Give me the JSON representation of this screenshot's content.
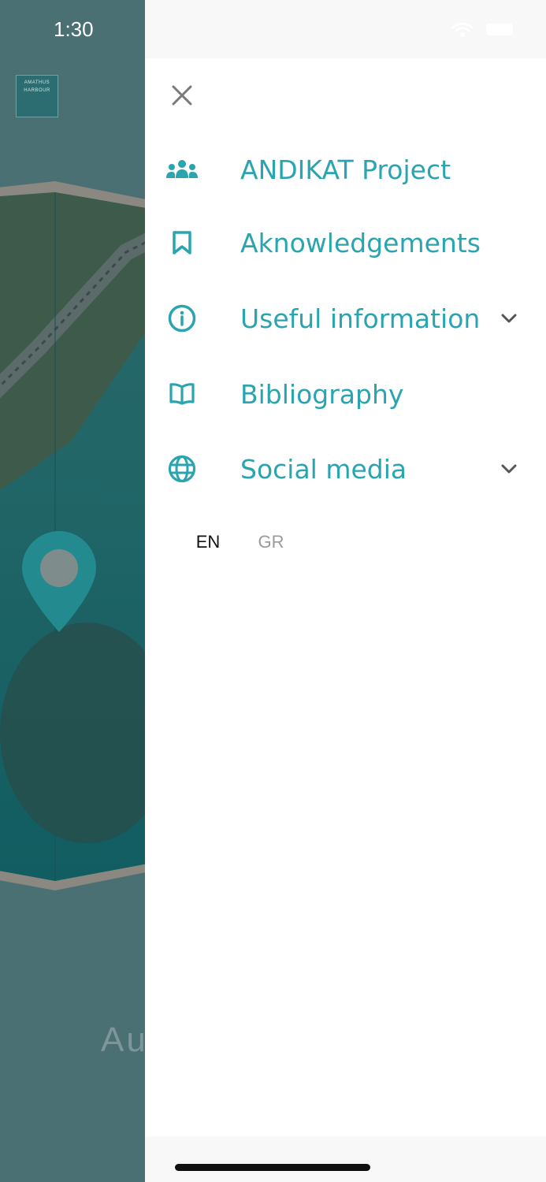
{
  "status_bar": {
    "time": "1:30"
  },
  "background": {
    "logo_line1": "AMATHUS",
    "logo_line2": "HARBOUR",
    "caption_partial": "Au"
  },
  "drawer": {
    "menu": [
      {
        "label": "ANDIKAT Project",
        "icon": "people-group-icon",
        "expandable": false
      },
      {
        "label": "Aknowledgements",
        "icon": "bookmark-icon",
        "expandable": false
      },
      {
        "label": "Useful information",
        "icon": "info-circle-icon",
        "expandable": true
      },
      {
        "label": "Bibliography",
        "icon": "open-book-icon",
        "expandable": false
      },
      {
        "label": "Social media",
        "icon": "globe-icon",
        "expandable": true
      }
    ],
    "languages": {
      "en": "EN",
      "gr": "GR",
      "selected": "EN"
    }
  },
  "colors": {
    "accent": "#2aa5b0",
    "text_selected": "#111111",
    "text_muted": "#9a9a9a",
    "icon_gray": "#7a7a7a"
  }
}
